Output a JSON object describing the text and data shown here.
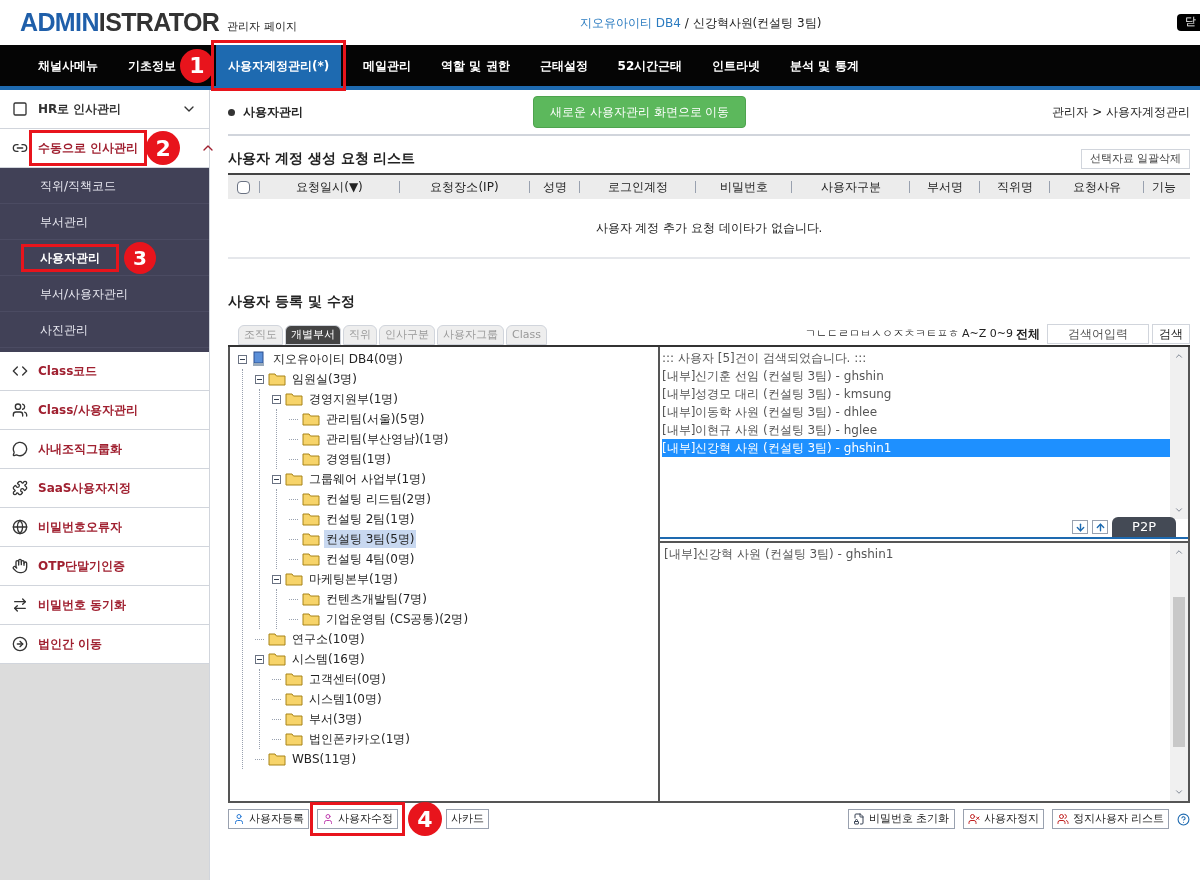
{
  "header": {
    "logo_strong": "ADMIN",
    "logo_rest": "ISTRATOR",
    "subtitle": "관리자 페이지",
    "company": "지오유아이티 DB4",
    "user": " / 신강혁사원(컨설팅 3팀)",
    "close": "닫"
  },
  "nav": [
    {
      "label": "채널사메뉴",
      "selected": false
    },
    {
      "label": "기초정보",
      "selected": false
    },
    {
      "label": "사용자계정관리(*)",
      "selected": true,
      "annotation": "1"
    },
    {
      "label": "메일관리",
      "selected": false
    },
    {
      "label": "역할 및 권한",
      "selected": false
    },
    {
      "label": "근태설정",
      "selected": false
    },
    {
      "label": "52시간근태",
      "selected": false
    },
    {
      "label": "인트라넷",
      "selected": false
    },
    {
      "label": "분석 및 통계",
      "selected": false
    }
  ],
  "sidebar": [
    {
      "label": "HR로 인사관리",
      "expanded": false
    },
    {
      "label": "수동으로 인사관리",
      "expanded": true,
      "annotation": "2",
      "children": [
        {
          "label": "직위/직책코드",
          "selected": false
        },
        {
          "label": "부서관리",
          "selected": false
        },
        {
          "label": "사용자관리",
          "selected": true,
          "annotation": "3"
        },
        {
          "label": "부서/사용자관리",
          "selected": false
        },
        {
          "label": "사진관리",
          "selected": false
        }
      ]
    },
    {
      "label": "Class코드"
    },
    {
      "label": "Class/사용자관리"
    },
    {
      "label": "사내조직그룹화"
    },
    {
      "label": "SaaS사용자지정"
    },
    {
      "label": "비밀번호오류자"
    },
    {
      "label": "OTP단말기인증"
    },
    {
      "label": "비밀번호 동기화"
    },
    {
      "label": "법인간 이동"
    }
  ],
  "page": {
    "title": "사용자관리",
    "new_screen_button": "새로운 사용자관리 화면으로 이동",
    "breadcrumb": "관리자 > 사용자계정관리"
  },
  "request_list": {
    "title": "사용자 계정 생성 요청 리스트",
    "delete_button": "선택자료 일괄삭제",
    "select_all": false,
    "columns": [
      "요청일시(▼)",
      "요청장소(IP)",
      "성명",
      "로그인계정",
      "비밀번호",
      "사용자구분",
      "부서명",
      "직위명",
      "요청사유",
      "기능"
    ],
    "empty": "사용자 계정 추가 요청 데이타가 없습니다."
  },
  "edit": {
    "title": "사용자 등록 및 수정",
    "tabs": [
      {
        "label": "조직도",
        "selected": false
      },
      {
        "label": "개별부서",
        "selected": true
      },
      {
        "label": "직위",
        "selected": false
      },
      {
        "label": "인사구분",
        "selected": false
      },
      {
        "label": "사용자그룹",
        "selected": false
      },
      {
        "label": "Class",
        "selected": false
      }
    ],
    "index": "ㄱㄴㄷㄹㅁㅂㅅㅇㅈㅊㅋㅌㅍㅎ A~Z 0~9",
    "index_all": "전체",
    "search_placeholder": "검색어입력",
    "search_button": "검색",
    "tree": [
      {
        "label": "지오유아이티 DB4(0명)",
        "kind": "root",
        "expanded": true,
        "selected": false,
        "children": [
          {
            "label": "임원실(3명)",
            "kind": "folder",
            "expanded": true,
            "selected": false,
            "children": [
              {
                "label": "경영지원부(1명)",
                "kind": "folder",
                "expanded": true,
                "selected": false,
                "children": [
                  {
                    "label": "관리팀(서울)(5명)",
                    "kind": "folder",
                    "selected": false
                  },
                  {
                    "label": "관리팀(부산영남)(1명)",
                    "kind": "folder",
                    "selected": false
                  },
                  {
                    "label": "경영팀(1명)",
                    "kind": "folder",
                    "selected": false
                  }
                ]
              },
              {
                "label": "그룹웨어 사업부(1명)",
                "kind": "folder",
                "expanded": true,
                "selected": false,
                "children": [
                  {
                    "label": "컨설팅 리드팀(2명)",
                    "kind": "folder",
                    "selected": false
                  },
                  {
                    "label": "컨설팅 2팀(1명)",
                    "kind": "folder",
                    "selected": false
                  },
                  {
                    "label": "컨설팅 3팀(5명)",
                    "kind": "folder",
                    "selected": true
                  },
                  {
                    "label": "컨설팅 4팀(0명)",
                    "kind": "folder",
                    "selected": false
                  }
                ]
              },
              {
                "label": "마케팅본부(1명)",
                "kind": "folder",
                "expanded": true,
                "selected": false,
                "children": [
                  {
                    "label": "컨텐츠개발팀(7명)",
                    "kind": "folder",
                    "selected": false
                  },
                  {
                    "label": "기업운영팀 (CS공통)(2명)",
                    "kind": "folder",
                    "selected": false
                  }
                ]
              }
            ]
          },
          {
            "label": "연구소(10명)",
            "kind": "folder",
            "selected": false
          },
          {
            "label": "시스템(16명)",
            "kind": "folder",
            "expanded": true,
            "selected": false,
            "children": [
              {
                "label": "고객센터(0명)",
                "kind": "folder",
                "selected": false
              },
              {
                "label": "시스템1(0명)",
                "kind": "folder",
                "selected": false
              },
              {
                "label": "부서(3명)",
                "kind": "folder",
                "selected": false
              },
              {
                "label": "법인폰카카오(1명)",
                "kind": "folder",
                "selected": false
              }
            ]
          },
          {
            "label": "WBS(11명)",
            "kind": "folder",
            "selected": false
          }
        ]
      }
    ],
    "result_note": "::: 사용자 [5]건이 검색되었습니다. :::",
    "users": [
      {
        "label": "[내부]신기훈 선임 (컨설팅 3팀) - ghshin",
        "selected": false
      },
      {
        "label": "[내부]성경모 대리 (컨설팅 3팀) - kmsung",
        "selected": false
      },
      {
        "label": "[내부]이동학 사원 (컨설팅 3팀) - dhlee",
        "selected": false
      },
      {
        "label": "[내부]이현규 사원 (컨설팅 3팀) - hglee",
        "selected": false
      },
      {
        "label": "[내부]신강혁 사원 (컨설팅 3팀) - ghshin1",
        "selected": true
      }
    ],
    "p2p": "P2P",
    "picked": [
      "[내부]신강혁 사원 (컨설팅 3팀) - ghshin1"
    ],
    "left_buttons": [
      {
        "label": "사용자등록"
      },
      {
        "label": "사용자수정",
        "annotation": "4"
      }
    ],
    "card_button": "사카드",
    "right_buttons": [
      {
        "label": "비밀번호 초기화"
      },
      {
        "label": "사용자정지"
      },
      {
        "label": "정지사용자 리스트"
      }
    ]
  }
}
